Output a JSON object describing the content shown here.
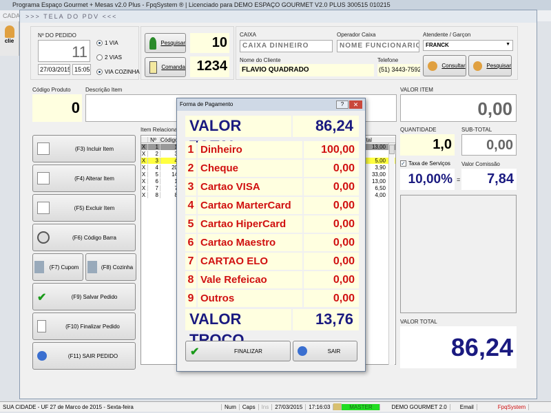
{
  "app": {
    "title": "Programa Espaço Gourmet + Mesas v2.0 Plus - FpqSystem ® | Licenciado para  DEMO ESPAÇO GOURMET V2.0 PLUS 300515 010215",
    "menu": "CADA",
    "toolbar_label": "clie"
  },
  "window": {
    "title": ">>> TELA DO PDV <<<"
  },
  "order": {
    "label": "Nº DO PEDIDO",
    "number": "11",
    "date": "27/03/2015",
    "time": "15:05",
    "radios": [
      {
        "label": "1 VIA",
        "checked": true
      },
      {
        "label": "2 VIAS",
        "checked": false
      },
      {
        "label": "VIA COZINHA",
        "checked": true
      }
    ]
  },
  "mesa": {
    "search_label": "Pesquisar",
    "mesa_value": "10",
    "comanda_label": "Comanda",
    "comanda_value": "1234"
  },
  "caixa": {
    "caixa_label": "CAIXA",
    "caixa_value": "CAIXA DINHEIRO",
    "operador_label": "Operador Caixa",
    "operador_value": "NOME FUNCIONARIO",
    "atendente_label": "Atendente / Garçon",
    "atendente_value": "FRANCK",
    "cliente_label": "Nome do Cliente",
    "cliente_value": "FLAVIO QUADRADO",
    "telefone_label": "Telefone",
    "telefone_value": "(51) 3443-7592",
    "consultar_label": "Consultar",
    "pesquisar_label": "Pesquisar"
  },
  "product": {
    "code_label": "Código Produto",
    "code_value": "0",
    "desc_label": "Descrição Item",
    "valor_item_label": "VALOR ITEM",
    "valor_item": "0,00",
    "qty_label": "QUANTIDADE",
    "qty": "1,0",
    "subtotal_label": "SUB-TOTAL",
    "subtotal": "0,00",
    "taxa_label": "Taxa de Serviços",
    "taxa": "10,00%",
    "comissao_label": "Valor Comissão",
    "comissao": "7,84",
    "eq": "=",
    "total_label": "VALOR TOTAL",
    "total": "86,24"
  },
  "actions": {
    "incluir": "(F3) Incluir Item",
    "alterar": "(F4) Alterar Item",
    "excluir": "(F5) Excluir Item",
    "barra": "(F6) Código Barra",
    "cupom": "(F7) Cupom",
    "cozinha": "(F8) Cozinha",
    "salvar": "(F9) Salvar Pedido",
    "finalizar": "(F10) Finalizar Pedido",
    "sair": "(F11) SAIR PEDIDO"
  },
  "grid": {
    "label": "Item Relacionado",
    "headers": [
      "Nº",
      "Código",
      "Total"
    ],
    "rows": [
      {
        "x": "X",
        "n": "1",
        "code": "1",
        "total": "13,00"
      },
      {
        "x": "X",
        "n": "2",
        "code": "3",
        "total": ""
      },
      {
        "x": "X",
        "n": "3",
        "code": "4",
        "total": "5,00"
      },
      {
        "x": "X",
        "n": "4",
        "code": "20",
        "total": "3,90"
      },
      {
        "x": "X",
        "n": "5",
        "code": "14",
        "total": "33,00"
      },
      {
        "x": "X",
        "n": "6",
        "code": "1",
        "total": "13,00"
      },
      {
        "x": "X",
        "n": "7",
        "code": "7",
        "total": "6,50"
      },
      {
        "x": "X",
        "n": "8",
        "code": "8",
        "total": "4,00"
      }
    ]
  },
  "dialog": {
    "title": "Forma de Pagamento",
    "help": "?",
    "total_label": "VALOR TOTAL",
    "total": "86,24",
    "payments": [
      {
        "n": "1",
        "name": "Dinheiro",
        "value": "100,00"
      },
      {
        "n": "2",
        "name": "Cheque",
        "value": "0,00"
      },
      {
        "n": "3",
        "name": "Cartao VISA",
        "value": "0,00"
      },
      {
        "n": "4",
        "name": "Cartao MarterCard",
        "value": "0,00"
      },
      {
        "n": "5",
        "name": "Cartao HiperCard",
        "value": "0,00"
      },
      {
        "n": "6",
        "name": "Cartao Maestro",
        "value": "0,00"
      },
      {
        "n": "7",
        "name": "CARTAO ELO",
        "value": "0,00"
      },
      {
        "n": "8",
        "name": "Vale Refeicao",
        "value": "0,00"
      },
      {
        "n": "9",
        "name": "Outros",
        "value": "0,00"
      }
    ],
    "troco_label": "VALOR TROCO",
    "troco": "13,76",
    "finalizar": "FINALIZAR",
    "sair": "SAIR"
  },
  "status": {
    "city": "SUA CIDADE - UF 27 de Marco de 2015 - Sexta-feira",
    "num": "Num",
    "caps": "Caps",
    "ins": "Ins",
    "date": "27/03/2015",
    "time": "17:16:03",
    "user": "MASTER",
    "company": "DEMO GOURMET 2.0",
    "email": "Email",
    "brand": "FpqSystem"
  },
  "colors": {
    "accent": "#1a1a80",
    "red": "#d01010",
    "yellow": "#ffffe0",
    "highlight": "#ffff40",
    "master": "#22dd22"
  }
}
